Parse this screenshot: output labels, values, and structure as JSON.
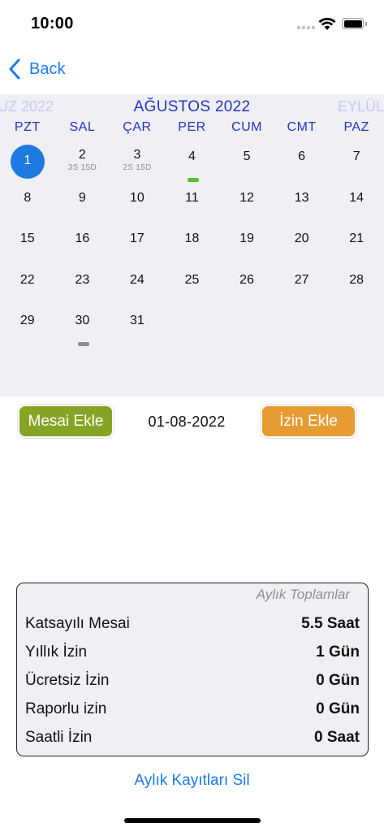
{
  "status_bar": {
    "time": "10:00"
  },
  "nav": {
    "back_label": "Back"
  },
  "calendar": {
    "prev_month": "UZ 2022",
    "current_month": "AĞUSTOS 2022",
    "next_month": "EYLÜL",
    "weekdays": [
      "PZT",
      "SAL",
      "ÇAR",
      "PER",
      "CUM",
      "CMT",
      "PAZ"
    ],
    "weeks": [
      [
        {
          "day": "1",
          "selected": true
        },
        {
          "day": "2",
          "sub": "3S 15D"
        },
        {
          "day": "3",
          "sub": "2S 15D"
        },
        {
          "day": "4",
          "marker": "green"
        },
        {
          "day": "5"
        },
        {
          "day": "6"
        },
        {
          "day": "7"
        }
      ],
      [
        {
          "day": "8"
        },
        {
          "day": "9"
        },
        {
          "day": "10"
        },
        {
          "day": "11"
        },
        {
          "day": "12"
        },
        {
          "day": "13"
        },
        {
          "day": "14"
        }
      ],
      [
        {
          "day": "15"
        },
        {
          "day": "16"
        },
        {
          "day": "17"
        },
        {
          "day": "18"
        },
        {
          "day": "19"
        },
        {
          "day": "20"
        },
        {
          "day": "21"
        }
      ],
      [
        {
          "day": "22"
        },
        {
          "day": "23"
        },
        {
          "day": "24"
        },
        {
          "day": "25"
        },
        {
          "day": "26"
        },
        {
          "day": "27"
        },
        {
          "day": "28"
        }
      ],
      [
        {
          "day": "29"
        },
        {
          "day": "30",
          "marker": "gray"
        },
        {
          "day": "31"
        }
      ]
    ],
    "colors": {
      "selected": "#1e7ae0",
      "header": "#2236c4",
      "marker_green": "#5dbe2c",
      "marker_gray": "#8e8e93"
    }
  },
  "actions": {
    "mesai_label": "Mesai Ekle",
    "selected_date": "01-08-2022",
    "izin_label": "İzin Ekle",
    "mesai_color": "#86a423",
    "izin_color": "#e79c33"
  },
  "totals": {
    "title": "Aylık Toplamlar",
    "rows": [
      {
        "label": "Katsayılı Mesai",
        "value": "5.5 Saat"
      },
      {
        "label": "Yıllık İzin",
        "value": "1 Gün"
      },
      {
        "label": "Ücretsiz İzin",
        "value": "0 Gün"
      },
      {
        "label": "Raporlu izin",
        "value": "0 Gün"
      },
      {
        "label": "Saatli İzin",
        "value": "0 Saat"
      }
    ]
  },
  "footer": {
    "delete_label": "Aylık Kayıtları Sil"
  }
}
